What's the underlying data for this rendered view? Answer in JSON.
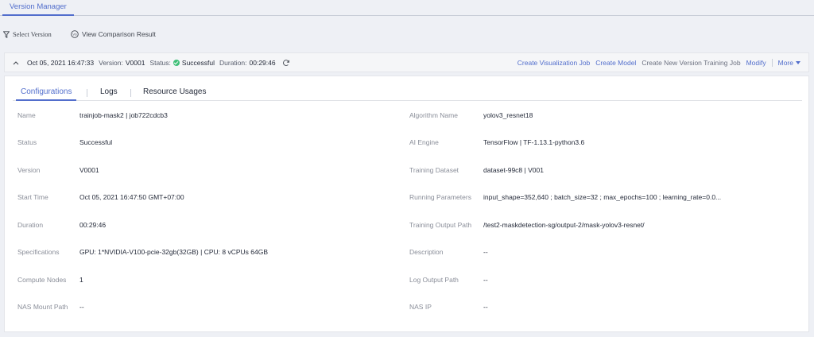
{
  "top_tab": {
    "label": "Version Manager"
  },
  "toolbar": {
    "select_version": "Select Version",
    "view_comparison": "View Comparison Result"
  },
  "version_header": {
    "timestamp": "Oct 05, 2021 16:47:33",
    "version_label": "Version:",
    "version_value": "V0001",
    "status_label": "Status:",
    "status_value": "Successful",
    "duration_label": "Duration:",
    "duration_value": "00:29:46",
    "actions": {
      "create_visualization_job": "Create Visualization Job",
      "create_model": "Create Model",
      "create_new_version": "Create New Version Training Job",
      "modify": "Modify",
      "more": "More"
    }
  },
  "tabs": {
    "configurations": "Configurations",
    "logs": "Logs",
    "resource_usages": "Resource Usages"
  },
  "details": {
    "left": [
      {
        "label": "Name",
        "value": "trainjob-mask2 | job722cdcb3"
      },
      {
        "label": "Status",
        "value": "Successful"
      },
      {
        "label": "Version",
        "value": "V0001"
      },
      {
        "label": "Start Time",
        "value": "Oct 05, 2021 16:47:50 GMT+07:00"
      },
      {
        "label": "Duration",
        "value": "00:29:46"
      },
      {
        "label": "Specifications",
        "value": "GPU: 1*NVIDIA-V100-pcie-32gb(32GB) | CPU: 8 vCPUs 64GB"
      },
      {
        "label": "Compute Nodes",
        "value": "1"
      },
      {
        "label": "NAS Mount Path",
        "value": "--"
      }
    ],
    "right": [
      {
        "label": "Algorithm Name",
        "value": "yolov3_resnet18"
      },
      {
        "label": "AI Engine",
        "value": "TensorFlow | TF-1.13.1-python3.6"
      },
      {
        "label": "Training Dataset",
        "value": "dataset-99c8 | V001"
      },
      {
        "label": "Running Parameters",
        "value": "input_shape=352,640 ; batch_size=32 ; max_epochs=100 ; learning_rate=0.0..."
      },
      {
        "label": "Training Output Path",
        "value": "/test2-maskdetection-sg/output-2/mask-yolov3-resnet/"
      },
      {
        "label": "Description",
        "value": "--"
      },
      {
        "label": "Log Output Path",
        "value": "--"
      },
      {
        "label": "NAS IP",
        "value": "--"
      }
    ]
  },
  "colors": {
    "accent": "#526ecc",
    "success": "#3fbf78",
    "label": "#8a8e99",
    "background": "#eef0f5"
  }
}
